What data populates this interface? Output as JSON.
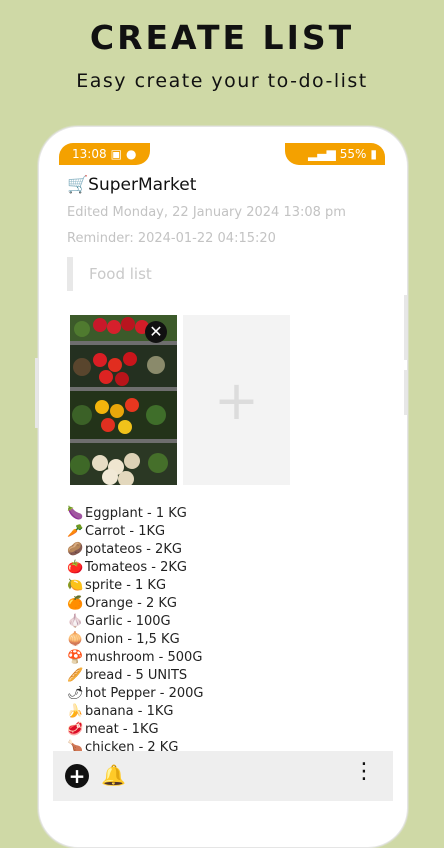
{
  "banner": {
    "title": "CREATE LIST",
    "subtitle": "Easy create your to-do-list"
  },
  "status_bar": {
    "time": "13:08",
    "battery": "55%"
  },
  "note": {
    "title": "🛒SuperMarket",
    "edited": "Edited Monday, 22 January 2024 13:08 pm",
    "reminder": "Reminder: 2024-01-22 04:15:20",
    "quote": "Food list"
  },
  "attachments": {
    "close_glyph": "✕",
    "add_glyph": "+"
  },
  "items": [
    {
      "emoji": "🍆",
      "text": "Eggplant - 1 KG"
    },
    {
      "emoji": "🥕",
      "text": "Carrot - 1KG"
    },
    {
      "emoji": "🥔",
      "text": "potateos - 2KG"
    },
    {
      "emoji": "🍅",
      "text": "Tomateos - 2KG"
    },
    {
      "emoji": "🍋",
      "text": "sprite - 1 KG"
    },
    {
      "emoji": "🍊",
      "text": "Orange - 2 KG"
    },
    {
      "emoji": "🧄",
      "text": "Garlic - 100G"
    },
    {
      "emoji": "🧅",
      "text": "Onion - 1,5 KG"
    },
    {
      "emoji": "🍄",
      "text": "mushroom - 500G"
    },
    {
      "emoji": "🥖",
      "text": "bread - 5 UNITS"
    },
    {
      "emoji": "🌶",
      "text": "hot Pepper - 200G"
    },
    {
      "emoji": "🍌",
      "text": "banana - 1KG"
    },
    {
      "emoji": "🥩",
      "text": "meat - 1KG"
    },
    {
      "emoji": "🍗",
      "text": "chicken - 2 KG"
    }
  ],
  "toolbar": {
    "add_glyph": "+",
    "bell_glyph": "🔔",
    "more_glyph": "⋮"
  }
}
